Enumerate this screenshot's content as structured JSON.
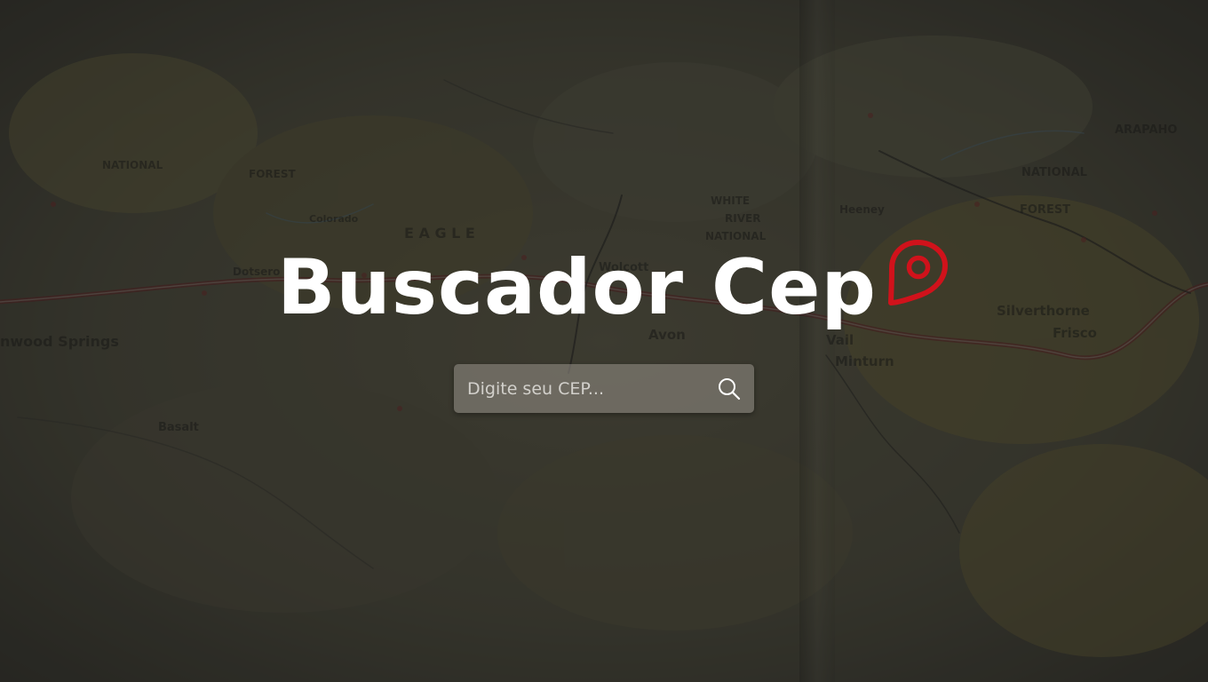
{
  "header": {
    "title": "Buscador Cep",
    "title_icon": "location-pin-icon",
    "icon_color": "#d0121b"
  },
  "search": {
    "placeholder": "Digite seu CEP...",
    "value": "",
    "button_icon": "search-icon"
  },
  "background": {
    "image": "road-map-photo",
    "map_labels": [
      "NATIONAL",
      "FOREST",
      "Glenwood Springs",
      "Dotsero",
      "Wolcott",
      "Avon",
      "Vail",
      "Minturn",
      "WHITE RIVER NATIONAL",
      "Silverthorne",
      "Frisco",
      "ARAPAHO",
      "NATIONAL",
      "FOREST",
      "Heeney",
      "Basalt",
      "EAGLE",
      "Colorado"
    ]
  }
}
